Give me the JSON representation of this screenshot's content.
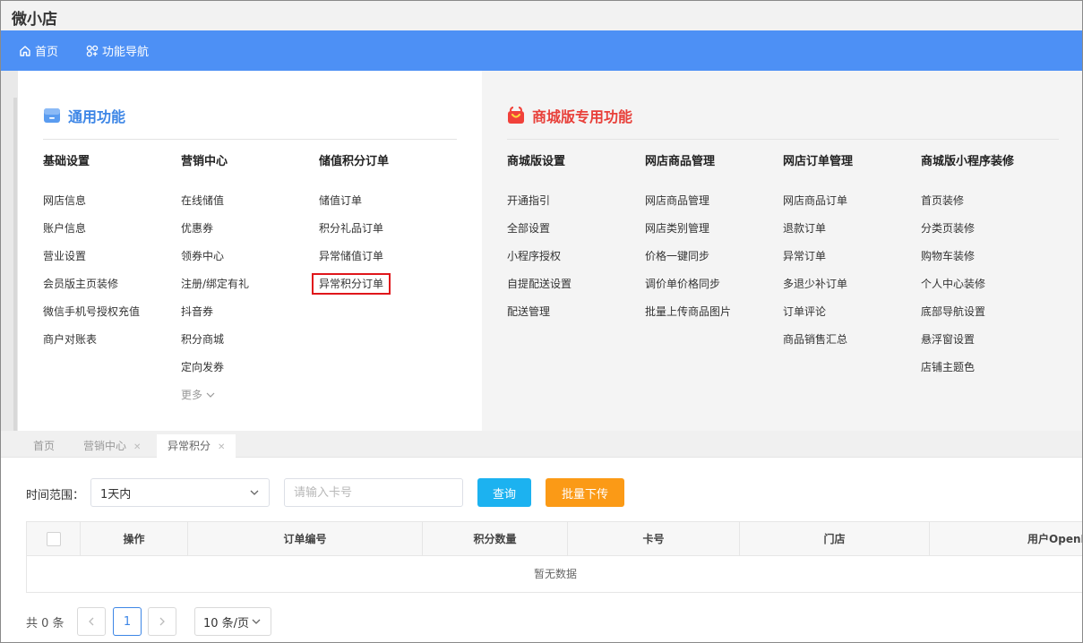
{
  "app": {
    "title": "微小店"
  },
  "nav": {
    "home": "首页",
    "function_nav": "功能导航"
  },
  "common": {
    "title": "通用功能",
    "columns": [
      {
        "head": "基础设置",
        "items": [
          "网店信息",
          "账户信息",
          "营业设置",
          "会员版主页装修",
          "微信手机号授权充值",
          "商户对账表"
        ]
      },
      {
        "head": "营销中心",
        "items": [
          "在线储值",
          "优惠券",
          "领券中心",
          "注册/绑定有礼",
          "抖音券",
          "积分商城",
          "定向发券"
        ],
        "more": "更多"
      },
      {
        "head": "储值积分订单",
        "items": [
          "储值订单",
          "积分礼品订单",
          "异常储值订单",
          "异常积分订单"
        ]
      }
    ]
  },
  "mall": {
    "title": "商城版专用功能",
    "columns": [
      {
        "head": "商城版设置",
        "items": [
          "开通指引",
          "全部设置",
          "小程序授权",
          "自提配送设置",
          "配送管理"
        ]
      },
      {
        "head": "网店商品管理",
        "items": [
          "网店商品管理",
          "网店类别管理",
          "价格一键同步",
          "调价单价格同步",
          "批量上传商品图片"
        ]
      },
      {
        "head": "网店订单管理",
        "items": [
          "网店商品订单",
          "退款订单",
          "异常订单",
          "多退少补订单",
          "订单评论",
          "商品销售汇总"
        ]
      },
      {
        "head": "商城版小程序装修",
        "items": [
          "首页装修",
          "分类页装修",
          "购物车装修",
          "个人中心装修",
          "底部导航设置",
          "悬浮窗设置",
          "店铺主题色"
        ]
      }
    ]
  },
  "tabs": [
    {
      "label": "首页",
      "closable": false
    },
    {
      "label": "营销中心",
      "closable": true
    },
    {
      "label": "异常积分",
      "closable": true,
      "active": true
    }
  ],
  "filter": {
    "time_label": "时间范围：",
    "time_value": "1天内",
    "card_placeholder": "请输入卡号",
    "query_button": "查询",
    "batch_button": "批量下传"
  },
  "table": {
    "columns": [
      "操作",
      "订单编号",
      "积分数量",
      "卡号",
      "门店",
      "用户OpenI"
    ],
    "empty_text": "暂无数据"
  },
  "pagination": {
    "total_text": "共 0 条",
    "current_page": "1",
    "page_size": "10 条/页"
  },
  "colors": {
    "nav_blue": "#4d90f5",
    "common_title": "#3d86e6",
    "mall_title": "#e8403a",
    "query_button": "#1cb2f0",
    "batch_button": "#fb9a16",
    "highlight_box": "#e0161b"
  }
}
